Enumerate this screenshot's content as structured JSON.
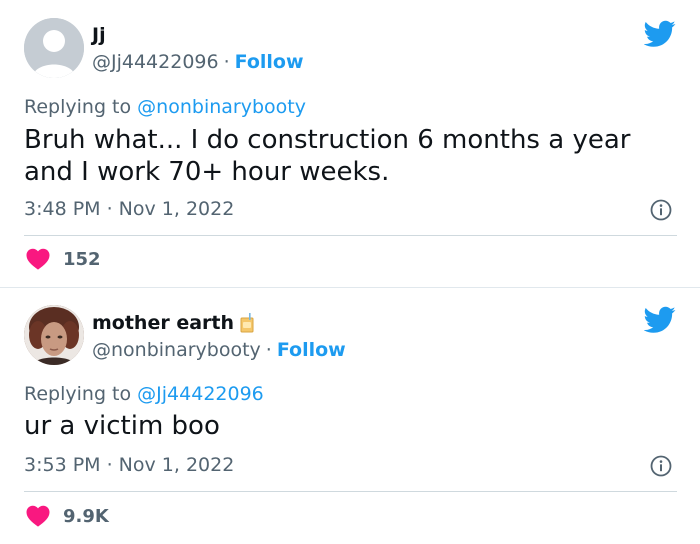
{
  "colors": {
    "link": "#1d9bf0",
    "muted": "#536471",
    "text": "#0f1419",
    "heart": "#f91880"
  },
  "tweets": [
    {
      "display_name": "Jj",
      "handle": "@Jj44422096",
      "separator": "·",
      "follow_label": "Follow",
      "replying_prefix": "Replying to",
      "replying_to": "@nonbinarybooty",
      "text": "Bruh what... I do construction 6 months a year and I work 70+ hour weeks.",
      "timestamp": "3:48 PM · Nov 1, 2022",
      "likes": "152",
      "icons": {
        "avatar": "default-avatar",
        "brand": "twitter-bird-icon",
        "info": "info-icon",
        "like": "heart-icon"
      }
    },
    {
      "display_name": "mother earth",
      "handle": "@nonbinarybooty",
      "separator": "·",
      "follow_label": "Follow",
      "replying_prefix": "Replying to",
      "replying_to": "@Jj44422096",
      "text": "ur a victim boo",
      "timestamp": "3:53 PM · Nov 1, 2022",
      "likes": "9.9K",
      "icons": {
        "avatar": "profile-photo",
        "name_emoji": "juice-box-icon",
        "brand": "twitter-bird-icon",
        "info": "info-icon",
        "like": "heart-icon"
      }
    }
  ]
}
